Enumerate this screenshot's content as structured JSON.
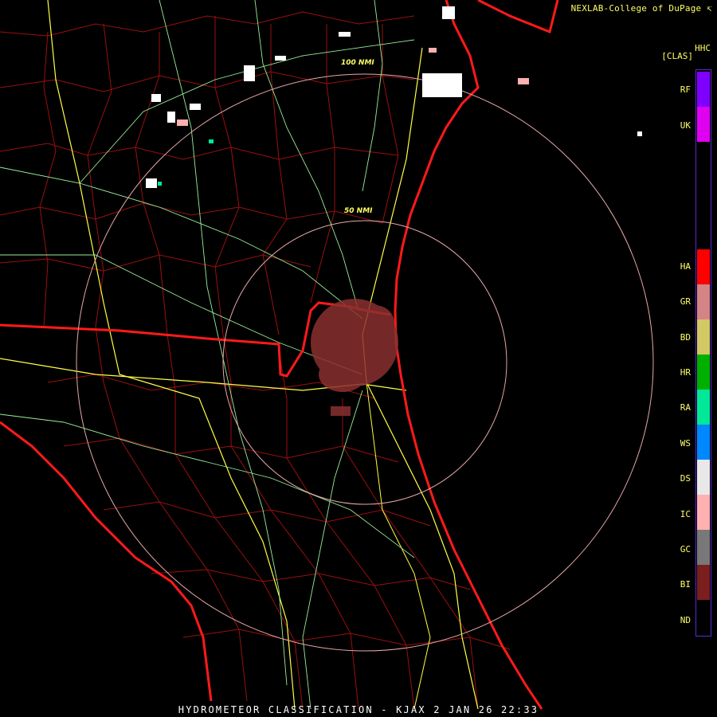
{
  "brand": "NEXLAB-College of DuPage",
  "brand_icon": "corner-arrow-icon",
  "product_code": "HHC",
  "product_class": "[CLAS]",
  "rings": [
    "100 NMI",
    "50 NMI"
  ],
  "legend": [
    {
      "code": "RF",
      "color": "#7f00ff"
    },
    {
      "code": "UK",
      "color": "#e000f0"
    },
    {
      "code": "HA",
      "color": "#ff0000"
    },
    {
      "code": "GR",
      "color": "#d48484"
    },
    {
      "code": "BD",
      "color": "#d2c864"
    },
    {
      "code": "HR",
      "color": "#00b000"
    },
    {
      "code": "RA",
      "color": "#00e898"
    },
    {
      "code": "WS",
      "color": "#0088ff"
    },
    {
      "code": "DS",
      "color": "#e8e8e8"
    },
    {
      "code": "IC",
      "color": "#ffb0b0"
    },
    {
      "code": "GC",
      "color": "#787878"
    },
    {
      "code": "BI",
      "color": "#7a1e1e"
    },
    {
      "code": "ND",
      "color": "#000000"
    }
  ],
  "footer": "HYDROMETEOR CLASSIFICATION - KJAX 2 JAN 26 22:33"
}
